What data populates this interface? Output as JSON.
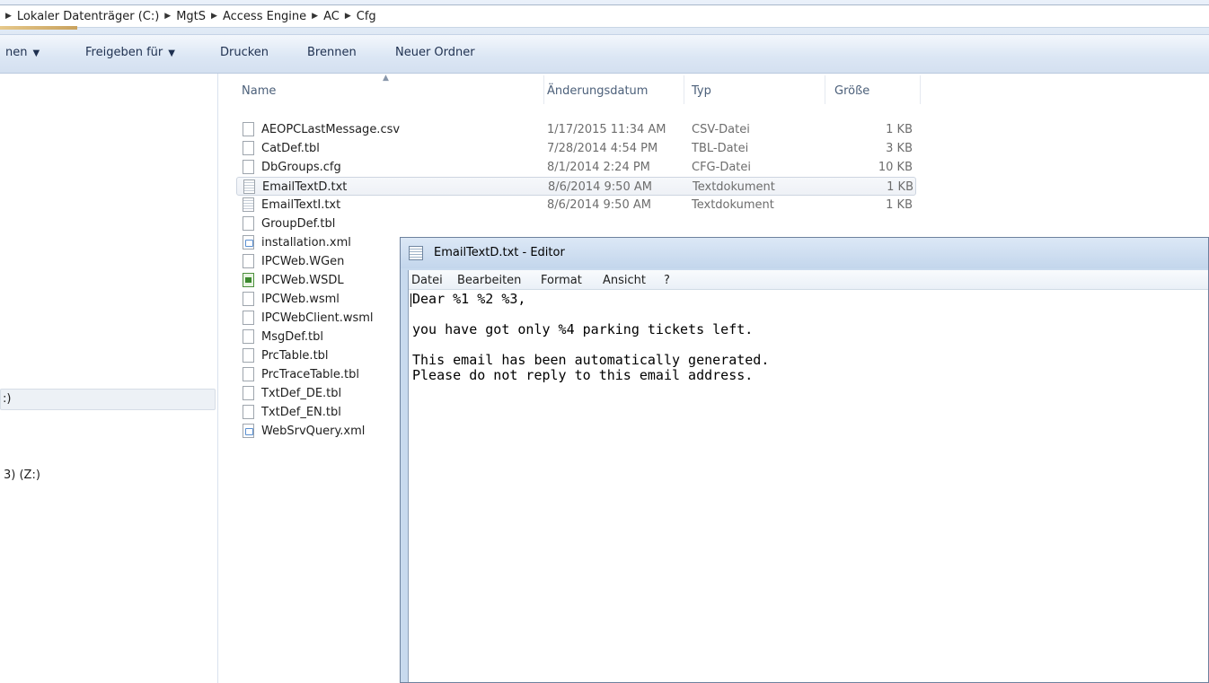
{
  "address_bar": {
    "breadcrumbs": [
      "Lokaler Datenträger (C:)",
      "MgtS",
      "Access Engine",
      "AC",
      "Cfg"
    ]
  },
  "toolbar": {
    "items": [
      {
        "label": "nen",
        "dropdown": true
      },
      {
        "label": "Freigeben für",
        "dropdown": true
      },
      {
        "label": "Drucken",
        "dropdown": false
      },
      {
        "label": "Brennen",
        "dropdown": false
      },
      {
        "label": "Neuer Ordner",
        "dropdown": false
      }
    ]
  },
  "nav": {
    "items": [
      ":)",
      "3) (Z:)"
    ]
  },
  "file_list": {
    "columns": {
      "name": "Name",
      "date": "Änderungsdatum",
      "type": "Typ",
      "size": "Größe"
    },
    "rows": [
      {
        "name": "AEOPCLastMessage.csv",
        "date": "1/17/2015 11:34 AM",
        "type": "CSV-Datei",
        "size": "1 KB",
        "icon": "file-icon"
      },
      {
        "name": "CatDef.tbl",
        "date": "7/28/2014 4:54 PM",
        "type": "TBL-Datei",
        "size": "3 KB",
        "icon": "file-icon"
      },
      {
        "name": "DbGroups.cfg",
        "date": "8/1/2014 2:24 PM",
        "type": "CFG-Datei",
        "size": "10 KB",
        "icon": "file-icon"
      },
      {
        "name": "EmailTextD.txt",
        "date": "8/6/2014 9:50 AM",
        "type": "Textdokument",
        "size": "1 KB",
        "icon": "text-file-icon",
        "selected": true
      },
      {
        "name": "EmailTextI.txt",
        "date": "8/6/2014 9:50 AM",
        "type": "Textdokument",
        "size": "1 KB",
        "icon": "text-file-icon"
      },
      {
        "name": "GroupDef.tbl",
        "icon": "file-icon"
      },
      {
        "name": "installation.xml",
        "icon": "xml-file-icon"
      },
      {
        "name": "IPCWeb.WGen",
        "icon": "file-icon"
      },
      {
        "name": "IPCWeb.WSDL",
        "icon": "wsdl-file-icon"
      },
      {
        "name": "IPCWeb.wsml",
        "icon": "file-icon"
      },
      {
        "name": "IPCWebClient.wsml",
        "icon": "file-icon"
      },
      {
        "name": "MsgDef.tbl",
        "icon": "file-icon"
      },
      {
        "name": "PrcTable.tbl",
        "icon": "file-icon"
      },
      {
        "name": "PrcTraceTable.tbl",
        "icon": "file-icon"
      },
      {
        "name": "TxtDef_DE.tbl",
        "icon": "file-icon"
      },
      {
        "name": "TxtDef_EN.tbl",
        "icon": "file-icon"
      },
      {
        "name": "WebSrvQuery.xml",
        "icon": "xml-file-icon"
      }
    ]
  },
  "notepad": {
    "title": "EmailTextD.txt - Editor",
    "menu": [
      "Datei",
      "Bearbeiten",
      "Format",
      "Ansicht",
      "?"
    ],
    "content": "Dear %1 %2 %3,\n\nyou have got only %4 parking tickets left.\n\nThis email has been automatically generated.\nPlease do not reply to this email address."
  }
}
